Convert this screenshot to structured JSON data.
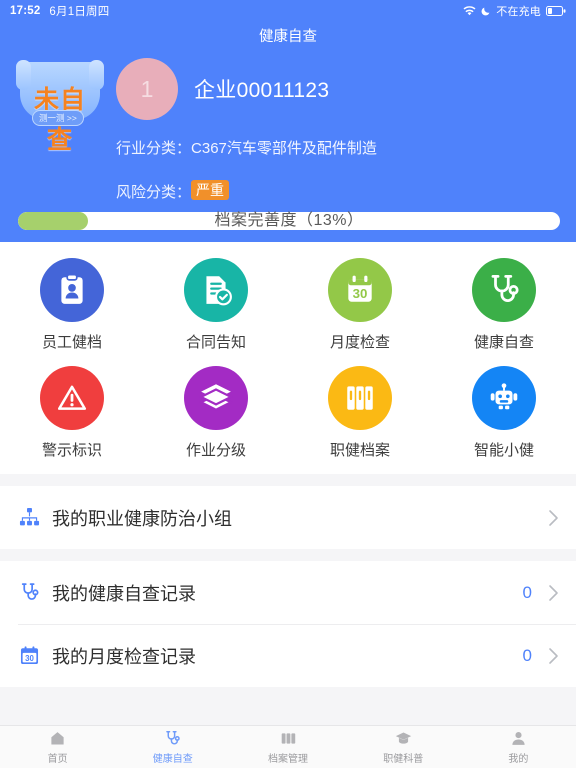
{
  "statusbar": {
    "time": "17:52",
    "date": "6月1日周四",
    "wifi_icon": "wifi-icon",
    "dnd_icon": "moon-icon",
    "charging_text": "不在充电",
    "battery_icon": "battery-icon"
  },
  "header": {
    "title": "健康自查",
    "bg_color": "#4F82FB",
    "selfcheck_badge": {
      "line1": "未自",
      "line2": "查",
      "cta": "测一测 >>",
      "text_color": "#F58220"
    },
    "avatar_initial": "1",
    "avatar_color": "#E8AEBA",
    "org_name": "企业00011123",
    "industry_label": "行业分类：",
    "industry_value": "C367汽车零部件及配件制造",
    "risk_label": "风险分类：",
    "risk_value": "严重",
    "risk_color": "#F1902A",
    "progress_text": "档案完善度（13%）",
    "progress_percent": 13,
    "progress_fill_color": "#A6D06C"
  },
  "grid": [
    {
      "label": "员工健档",
      "icon": "clipboard-person-icon",
      "color": "#4465D8"
    },
    {
      "label": "合同告知",
      "icon": "document-check-icon",
      "color": "#18B5A6"
    },
    {
      "label": "月度检查",
      "icon": "calendar-30-icon",
      "color": "#93C848"
    },
    {
      "label": "健康自查",
      "icon": "stethoscope-icon",
      "color": "#3BAF48"
    },
    {
      "label": "警示标识",
      "icon": "warning-triangle-icon",
      "color": "#F03E3E"
    },
    {
      "label": "作业分级",
      "icon": "layers-icon",
      "color": "#A32BC4"
    },
    {
      "label": "职健档案",
      "icon": "binders-icon",
      "color": "#FBB914"
    },
    {
      "label": "智能小健",
      "icon": "robot-icon",
      "color": "#1485F5"
    }
  ],
  "sections": [
    {
      "rows": [
        {
          "label": "我的职业健康防治小组",
          "icon": "org-chart-icon",
          "count": ""
        }
      ]
    },
    {
      "rows": [
        {
          "label": "我的健康自查记录",
          "icon": "stethoscope-icon",
          "count": "0"
        },
        {
          "label": "我的月度检查记录",
          "icon": "calendar-30-icon",
          "count": "0"
        }
      ]
    }
  ],
  "tabbar": {
    "items": [
      {
        "label": "首页",
        "icon": "home-icon",
        "active": false
      },
      {
        "label": "健康自查",
        "icon": "stethoscope-icon",
        "active": true
      },
      {
        "label": "档案管理",
        "icon": "archive-icon",
        "active": false
      },
      {
        "label": "职健科普",
        "icon": "graduation-cap-icon",
        "active": false
      },
      {
        "label": "我的",
        "icon": "person-icon",
        "active": false
      }
    ],
    "active_color": "#6F9BF9",
    "inactive_color": "#9B9B9E"
  }
}
